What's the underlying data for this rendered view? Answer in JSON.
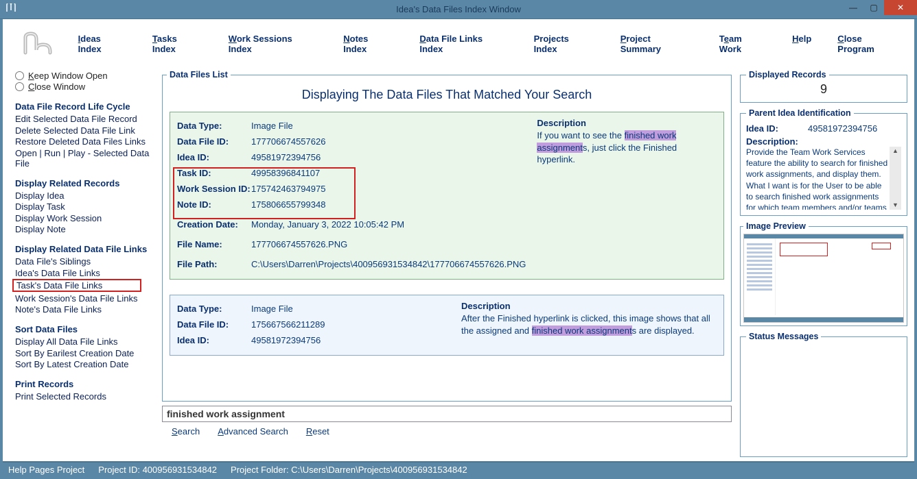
{
  "window": {
    "title": "Idea's Data Files Index Window"
  },
  "menu": {
    "ideas": "Ideas Index",
    "tasks": "Tasks Index",
    "work_sessions": "Work Sessions Index",
    "notes": "Notes Index",
    "data_file_links": "Data File Links Index",
    "projects": "Projects Index",
    "project_summary": "Project Summary",
    "team_work": "Team Work",
    "help": "Help",
    "close": "Close Program"
  },
  "left": {
    "keep_open": "eep Window Open",
    "close_window": "lose Window",
    "s1_hdr": "Data File Record Life Cycle",
    "s1": [
      "Edit Selected Data File Record",
      "Delete Selected Data File Link",
      "Restore Deleted Data Files Links",
      "Open | Run | Play - Selected Data File"
    ],
    "s2_hdr": "Display Related Records",
    "s2": [
      "Display Idea",
      "Display Task",
      "Display Work Session",
      "Display Note"
    ],
    "s3_hdr": "Display Related Data File Links",
    "s3a": [
      "Data File's Siblings",
      "Idea's Data File Links"
    ],
    "s3_highlight": "Task's Data File Links",
    "s3b": [
      "Work Session's Data File Links",
      "Note's Data File Links"
    ],
    "s4_hdr": "Sort Data Files",
    "s4": [
      "Display All Data File Links",
      "Sort By Earilest Creation Date",
      "Sort By Latest Creation Date"
    ],
    "s5_hdr": "Print Records",
    "s5": [
      "Print Selected Records"
    ]
  },
  "list": {
    "legend": "Data Files List",
    "title": "Displaying The Data Files That Matched Your Search",
    "records": [
      {
        "data_type_lbl": "Data Type:",
        "data_type": "Image File",
        "data_file_id_lbl": "Data File ID:",
        "data_file_id": "177706674557626",
        "idea_id_lbl": "Idea ID:",
        "idea_id": "49581972394756",
        "task_id_lbl": "Task ID:",
        "task_id": "49958396841107",
        "ws_id_lbl": "Work Session ID:",
        "ws_id": "175742463794975",
        "note_id_lbl": "Note ID:",
        "note_id": "175806655799348",
        "creation_lbl": "Creation Date:",
        "creation": "Monday, January 3, 2022   10:05:42 PM",
        "filename_lbl": "File Name:",
        "filename": "177706674557626.PNG",
        "filepath_lbl": "File Path:",
        "filepath": "C:\\Users\\Darren\\Projects\\400956931534842\\177706674557626.PNG",
        "desc_hdr": "Description",
        "desc_pre": "If you want to see the ",
        "desc_hl": "finished work assignment",
        "desc_post": "s, just click the Finished hyperlink."
      },
      {
        "data_type_lbl": "Data Type:",
        "data_type": "Image File",
        "data_file_id_lbl": "Data File ID:",
        "data_file_id": "175667566211289",
        "idea_id_lbl": "Idea ID:",
        "idea_id": "49581972394756",
        "desc_hdr": "Description",
        "desc_pre": "After the Finished hyperlink is clicked, this image shows that all the assigned and ",
        "desc_hl": "finished work assignment",
        "desc_post": "s are displayed."
      }
    ]
  },
  "search": {
    "value": "finished work assignment",
    "search": "earch",
    "advanced": "dvanced Search",
    "reset": "eset"
  },
  "right": {
    "disp_legend": "Displayed Records",
    "disp_count": "9",
    "parent_legend": "Parent Idea Identification",
    "idea_id_lbl": "Idea ID:",
    "idea_id": "49581972394756",
    "desc_lbl": "Description:",
    "desc": "Provide the Team Work Services feature the ability to search for finished work assignments, and display them. What I want is for the User to be able to search finished work assignments for which team members and/or teams worked on them",
    "preview_legend": "Image Preview",
    "status_legend": "Status Messages"
  },
  "status": {
    "help": "Help Pages Project",
    "proj_id": "Project ID:  400956931534842",
    "proj_folder": "Project Folder:  C:\\Users\\Darren\\Projects\\400956931534842"
  }
}
